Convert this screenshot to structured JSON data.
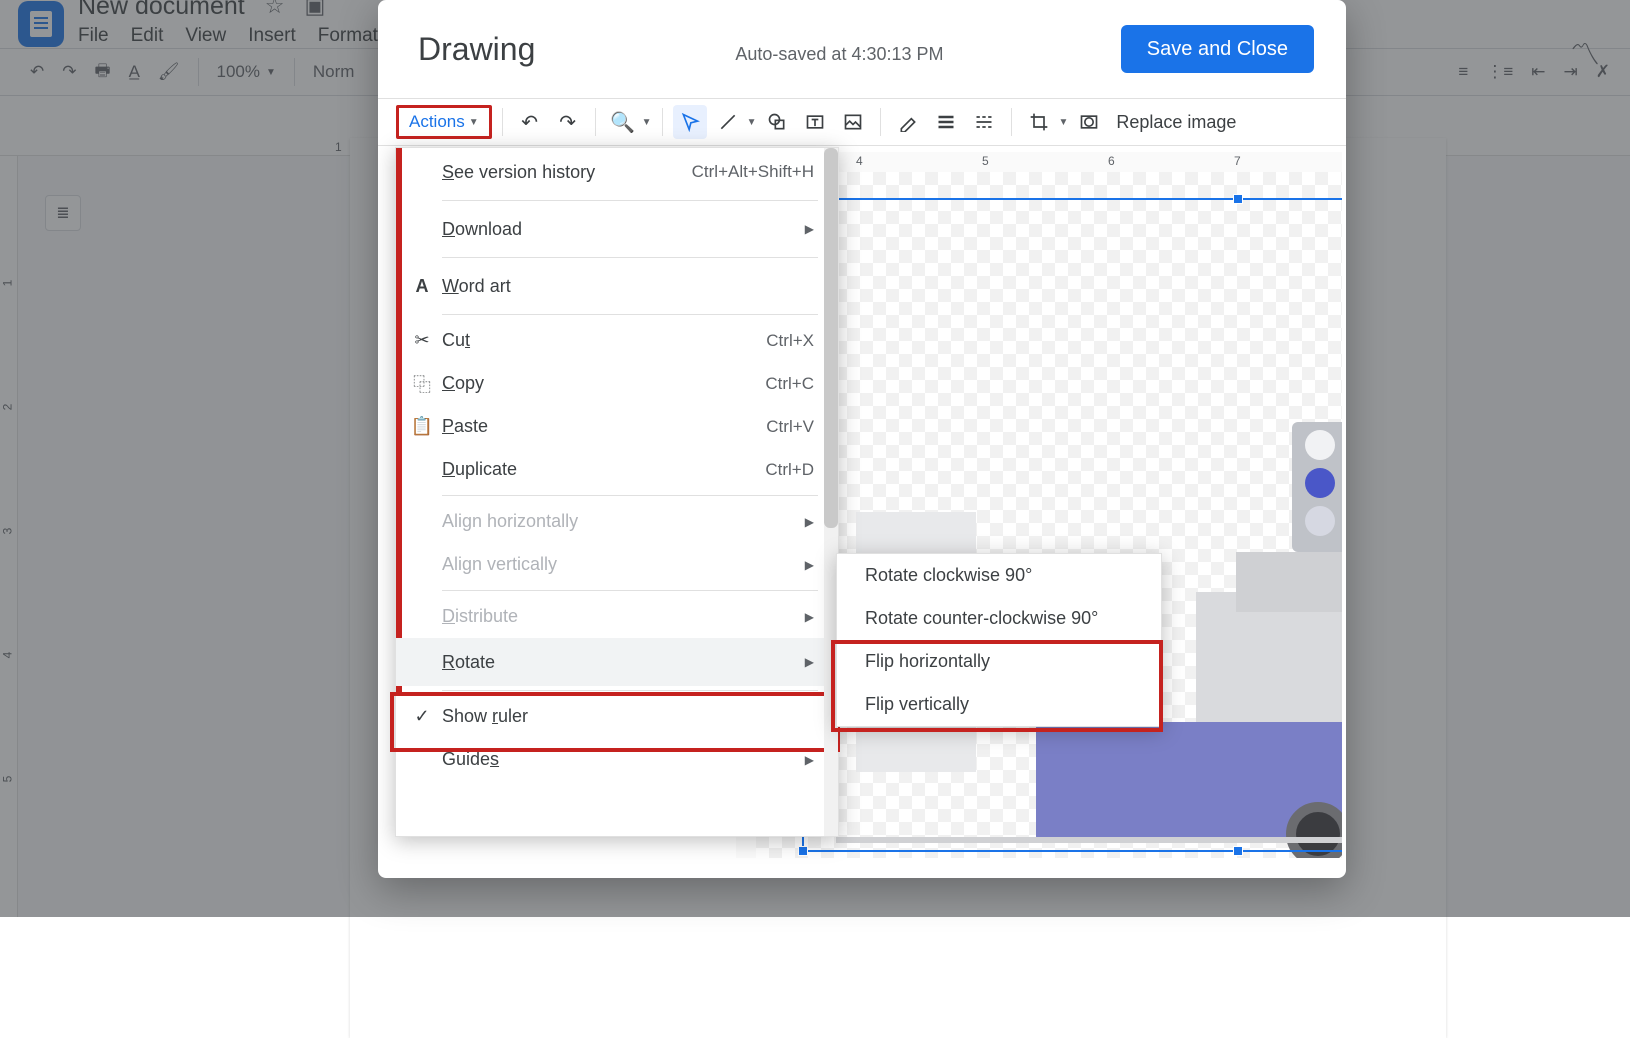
{
  "gdocs": {
    "title": "New document",
    "menu": [
      "File",
      "Edit",
      "View",
      "Insert",
      "Format"
    ],
    "zoom": "100%",
    "style_name": "Norm"
  },
  "dialog": {
    "title": "Drawing",
    "autosave": "Auto-saved at 4:30:13 PM",
    "save_btn": "Save and Close",
    "actions_btn": "Actions",
    "replace_img": "Replace image",
    "ruler_h": [
      "4",
      "5",
      "6",
      "7"
    ],
    "ruler_v": [
      "1",
      "2",
      "3",
      "4"
    ]
  },
  "actions_menu": {
    "version": {
      "label": "See version history",
      "shortcut": "Ctrl+Alt+Shift+H"
    },
    "download": {
      "label": "Download"
    },
    "wordart": {
      "label": "Word art"
    },
    "cut": {
      "label": "Cut",
      "shortcut": "Ctrl+X"
    },
    "copy": {
      "label": "Copy",
      "shortcut": "Ctrl+C"
    },
    "paste": {
      "label": "Paste",
      "shortcut": "Ctrl+V"
    },
    "dup": {
      "label": "Duplicate",
      "shortcut": "Ctrl+D"
    },
    "alignh": {
      "label": "Align horizontally"
    },
    "alignv": {
      "label": "Align vertically"
    },
    "distribute": {
      "label": "Distribute"
    },
    "rotate": {
      "label": "Rotate"
    },
    "show_ruler": {
      "label": "Show ruler"
    },
    "guides": {
      "label": "Guides"
    }
  },
  "rotate_submenu": {
    "cw": "Rotate clockwise 90°",
    "ccw": "Rotate counter-clockwise 90°",
    "fliph": "Flip horizontally",
    "flipv": "Flip vertically"
  }
}
